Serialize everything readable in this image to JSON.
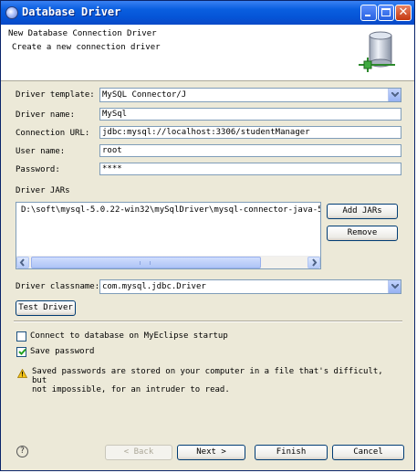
{
  "window": {
    "title": "Database Driver"
  },
  "banner": {
    "title": "New Database Connection Driver",
    "description": "Create a new connection driver"
  },
  "form": {
    "driver_template": {
      "label": "Driver template:",
      "value": "MySQL Connector/J"
    },
    "driver_name": {
      "label": "Driver name:",
      "value": "MySql"
    },
    "connection_url": {
      "label": "Connection URL:",
      "value": "jdbc:mysql://localhost:3306/studentManager"
    },
    "user_name": {
      "label": "User name:",
      "value": "root"
    },
    "password": {
      "label": "Password:",
      "value": "****"
    }
  },
  "driver_jars": {
    "label": "Driver JARs",
    "items": [
      "D:\\soft\\mysql-5.0.22-win32\\mySqlDriver\\mysql-connector-java-5."
    ],
    "add_button": "Add JARs",
    "remove_button": "Remove"
  },
  "driver_classname": {
    "label": "Driver classname:",
    "value": "com.mysql.jdbc.Driver"
  },
  "test_driver_button": "Test Driver",
  "options": {
    "connect_on_startup": {
      "label": "Connect to database on MyEclipse startup",
      "checked": false
    },
    "save_password": {
      "label": "Save password",
      "checked": true
    }
  },
  "warning": {
    "line1": "Saved passwords are stored on your computer in a file that's difficult, but",
    "line2": "not impossible, for an intruder to read."
  },
  "footer": {
    "back_label": "< Back",
    "next_label": "Next >",
    "finish_label": "Finish",
    "cancel_label": "Cancel"
  },
  "icons": {
    "app": "database-driver-icon",
    "banner": "database-cylinder-icon",
    "help": "help-icon",
    "warning": "warning-icon"
  },
  "colors": {
    "titlebar": "#0554d6",
    "dialog_bg": "#ece9d8",
    "field_border": "#7f9db9"
  }
}
